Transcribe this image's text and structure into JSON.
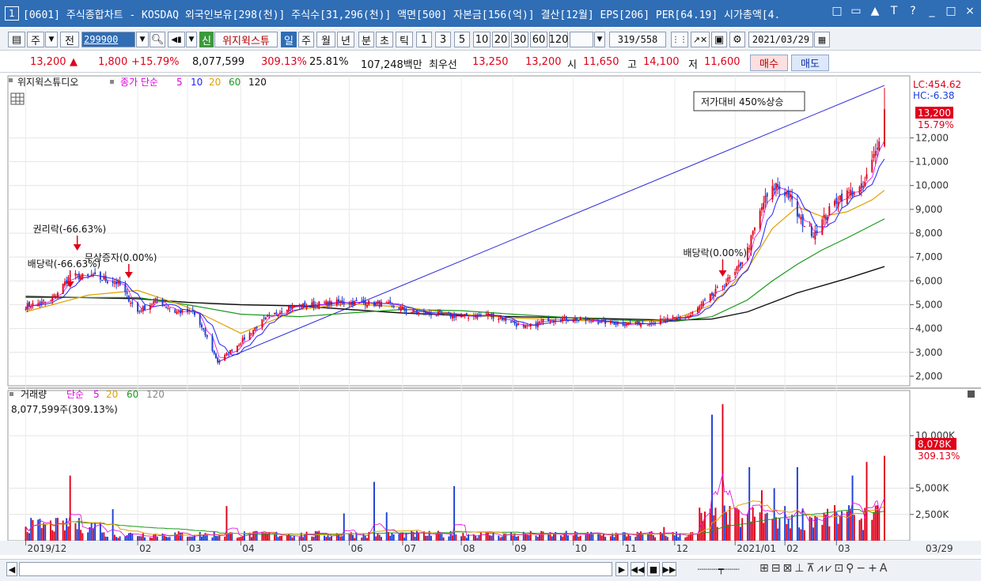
{
  "window": {
    "number": "1",
    "title": "[0601] 주식종합차트 - KOSDAQ 외국인보유[298(천)] 주식수[31,296(천)] 액면[500] 자본금[156(억)] 결산[12월] EPS[206] PER[64.19] 시가총액[4.",
    "controls": [
      "□",
      "▭",
      "▲",
      "T",
      "?",
      "_",
      "□",
      "×"
    ]
  },
  "toolbar": {
    "week_label": "주",
    "prev_label": "전",
    "stock_code": "299900",
    "stock_name": "위지윅스튜",
    "shin_label": "신",
    "periods": [
      "일",
      "주",
      "월",
      "년",
      "분",
      "초",
      "틱"
    ],
    "active_period": "일",
    "intervals": [
      "1",
      "3",
      "5",
      "10",
      "20",
      "30",
      "60",
      "120"
    ],
    "count": "319/558",
    "date": "2021/03/29"
  },
  "quote": {
    "price": "13,200",
    "up_symbol": "▲",
    "change": "1,800",
    "change_pct": "+15.79%",
    "volume": "8,077,599",
    "volume_ratio": "309.13%",
    "turnover": "25.81%",
    "amount": "107,248백만",
    "best_label": "최우선",
    "best_ask": "13,250",
    "best_bid": "13,200",
    "open_label": "시",
    "open": "11,650",
    "high_label": "고",
    "high": "14,100",
    "low_label": "저",
    "low": "11,600",
    "buy_label": "매수",
    "sell_label": "매도"
  },
  "price_panel": {
    "name": "위지윅스튜디오",
    "series_label": "종가 단순",
    "ma_labels": [
      "5",
      "10",
      "20",
      "60",
      "120"
    ],
    "lc": "LC:454.62",
    "hc": "HC:-6.38",
    "price_tag": "13,200",
    "pct_tag": "15.79%",
    "annotation_box": "저가대비 450%상승",
    "events": [
      "권리락(-66.63%)",
      "무상증자(0.00%)",
      "배당락(-66.63%)",
      "배당락(0.00%)"
    ]
  },
  "volume_panel": {
    "title": "거래량",
    "series_label": "단순",
    "ma_labels": [
      "5",
      "20",
      "60",
      "120"
    ],
    "current": "8,077,599주(309.13%)",
    "tag": "8,078K",
    "tag_pct": "309.13%"
  },
  "colors": {
    "up": "#e0001a",
    "down": "#1a3fd6",
    "ma5": "#e000e0",
    "ma10": "#2020ff",
    "ma20": "#e0a000",
    "ma60": "#1a9a1a",
    "ma120": "#111111",
    "trendline": "#2a2ad6",
    "title_bar": "#2f6db5"
  },
  "chart_data": [
    {
      "type": "candlestick",
      "title": "위지윅스튜디오",
      "ylim": [
        1600,
        14600
      ],
      "y_ticks": [
        2000,
        3000,
        4000,
        5000,
        6000,
        7000,
        8000,
        9000,
        10000,
        11000,
        12000
      ],
      "y_tick_labels": [
        "2,000",
        "3,000",
        "4,000",
        "5,000",
        "6,000",
        "7,000",
        "8,000",
        "9,000",
        "10,000",
        "11,000",
        "12,000"
      ],
      "x_labels": [
        {
          "label": "2019/12",
          "date": "2019-12-02"
        },
        {
          "label": "02",
          "date": "2020-02-03"
        },
        {
          "label": "03",
          "date": "2020-03-02"
        },
        {
          "label": "04",
          "date": "2020-04-01"
        },
        {
          "label": "05",
          "date": "2020-05-04"
        },
        {
          "label": "06",
          "date": "2020-06-01"
        },
        {
          "label": "07",
          "date": "2020-07-01"
        },
        {
          "label": "08",
          "date": "2020-08-03"
        },
        {
          "label": "09",
          "date": "2020-09-01"
        },
        {
          "label": "10",
          "date": "2020-10-05"
        },
        {
          "label": "11",
          "date": "2020-11-02"
        },
        {
          "label": "12",
          "date": "2020-12-01"
        },
        {
          "label": "2021/01",
          "date": "2021-01-04"
        },
        {
          "label": "02",
          "date": "2021-02-01"
        },
        {
          "label": "03",
          "date": "2021-03-02"
        },
        {
          "label": "03/29",
          "date": "2021-03-29"
        }
      ],
      "close_path": [
        [
          "2019-12-02",
          4950
        ],
        [
          "2019-12-16",
          5150
        ],
        [
          "2019-12-27",
          6200
        ],
        [
          "2020-01-10",
          6150
        ],
        [
          "2020-01-23",
          5900
        ],
        [
          "2020-02-03",
          4700
        ],
        [
          "2020-02-14",
          5200
        ],
        [
          "2020-02-24",
          4700
        ],
        [
          "2020-03-05",
          4700
        ],
        [
          "2020-03-13",
          3600
        ],
        [
          "2020-03-19",
          2600
        ],
        [
          "2020-03-30",
          3300
        ],
        [
          "2020-04-13",
          4300
        ],
        [
          "2020-04-27",
          4900
        ],
        [
          "2020-05-11",
          5000
        ],
        [
          "2020-05-25",
          5100
        ],
        [
          "2020-06-08",
          5100
        ],
        [
          "2020-06-22",
          5000
        ],
        [
          "2020-07-06",
          4700
        ],
        [
          "2020-07-20",
          4600
        ],
        [
          "2020-08-03",
          4500
        ],
        [
          "2020-08-18",
          4600
        ],
        [
          "2020-08-31",
          4300
        ],
        [
          "2020-09-07",
          4000
        ],
        [
          "2020-09-21",
          4400
        ],
        [
          "2020-10-05",
          4400
        ],
        [
          "2020-10-19",
          4300
        ],
        [
          "2020-11-02",
          4200
        ],
        [
          "2020-11-16",
          4250
        ],
        [
          "2020-11-30",
          4400
        ],
        [
          "2020-12-10",
          4550
        ],
        [
          "2020-12-22",
          5400
        ],
        [
          "2021-01-04",
          6300
        ],
        [
          "2021-01-11",
          7300
        ],
        [
          "2021-01-20",
          9300
        ],
        [
          "2021-01-27",
          10000
        ],
        [
          "2021-02-03",
          9600
        ],
        [
          "2021-02-09",
          8600
        ],
        [
          "2021-02-17",
          8000
        ],
        [
          "2021-02-24",
          8700
        ],
        [
          "2021-03-03",
          9500
        ],
        [
          "2021-03-10",
          9700
        ],
        [
          "2021-03-17",
          9900
        ],
        [
          "2021-03-24",
          11400
        ],
        [
          "2021-03-29",
          13200
        ]
      ],
      "last_candle": {
        "date": "2021-03-29",
        "open": 11650,
        "high": 14100,
        "low": 11600,
        "close": 13200
      },
      "moving_averages": {
        "ma20": [
          [
            "2019-12-02",
            4700
          ],
          [
            "2020-01-06",
            5400
          ],
          [
            "2020-02-03",
            5600
          ],
          [
            "2020-03-02",
            4900
          ],
          [
            "2020-04-01",
            3800
          ],
          [
            "2020-05-04",
            4800
          ],
          [
            "2020-06-01",
            5050
          ],
          [
            "2020-07-01",
            4900
          ],
          [
            "2020-08-03",
            4600
          ],
          [
            "2020-09-01",
            4450
          ],
          [
            "2020-10-05",
            4350
          ],
          [
            "2020-11-02",
            4250
          ],
          [
            "2020-12-01",
            4400
          ],
          [
            "2020-12-22",
            5000
          ],
          [
            "2021-01-11",
            6500
          ],
          [
            "2021-01-25",
            8200
          ],
          [
            "2021-02-08",
            9100
          ],
          [
            "2021-02-22",
            8700
          ],
          [
            "2021-03-08",
            8900
          ],
          [
            "2021-03-22",
            9400
          ],
          [
            "2021-03-29",
            9800
          ]
        ],
        "ma60": [
          [
            "2019-12-02",
            5300
          ],
          [
            "2020-02-03",
            5300
          ],
          [
            "2020-03-02",
            5000
          ],
          [
            "2020-04-01",
            4600
          ],
          [
            "2020-05-04",
            4500
          ],
          [
            "2020-06-01",
            4650
          ],
          [
            "2020-07-01",
            4800
          ],
          [
            "2020-08-03",
            4750
          ],
          [
            "2020-09-01",
            4600
          ],
          [
            "2020-10-05",
            4450
          ],
          [
            "2020-11-02",
            4350
          ],
          [
            "2020-12-01",
            4300
          ],
          [
            "2020-12-22",
            4500
          ],
          [
            "2021-01-11",
            5200
          ],
          [
            "2021-01-25",
            6000
          ],
          [
            "2021-02-08",
            6700
          ],
          [
            "2021-02-22",
            7300
          ],
          [
            "2021-03-08",
            7800
          ],
          [
            "2021-03-29",
            8600
          ]
        ],
        "ma120": [
          [
            "2019-12-02",
            5350
          ],
          [
            "2020-02-03",
            5250
          ],
          [
            "2020-03-02",
            5100
          ],
          [
            "2020-04-01",
            5000
          ],
          [
            "2020-05-04",
            4950
          ],
          [
            "2020-06-01",
            4800
          ],
          [
            "2020-07-01",
            4650
          ],
          [
            "2020-08-03",
            4550
          ],
          [
            "2020-09-01",
            4500
          ],
          [
            "2020-10-05",
            4450
          ],
          [
            "2020-11-02",
            4400
          ],
          [
            "2020-12-01",
            4350
          ],
          [
            "2020-12-22",
            4400
          ],
          [
            "2021-01-11",
            4700
          ],
          [
            "2021-01-25",
            5100
          ],
          [
            "2021-02-08",
            5500
          ],
          [
            "2021-02-22",
            5800
          ],
          [
            "2021-03-08",
            6100
          ],
          [
            "2021-03-29",
            6600
          ]
        ]
      },
      "trendline": [
        [
          "2020-03-19",
          2600
        ],
        [
          "2021-03-29",
          14200
        ]
      ],
      "event_markers": [
        {
          "label": "권리락(-66.63%)",
          "date": "2019-12-31"
        },
        {
          "label": "무상증자(0.00%)",
          "date": "2020-01-29"
        },
        {
          "label": "배당락(-66.63%)",
          "date": "2019-12-27"
        },
        {
          "label": "배당락(0.00%)",
          "date": "2020-12-28"
        }
      ]
    },
    {
      "type": "bar",
      "title": "거래량",
      "ylim": [
        0,
        14000
      ],
      "y_ticks": [
        2500,
        5000,
        10000
      ],
      "y_tick_labels": [
        "2,500K",
        "5,000K",
        "10,000K"
      ],
      "unit": "K",
      "spikes": [
        [
          "2019-12-27",
          6200
        ],
        [
          "2020-01-20",
          3000
        ],
        [
          "2020-03-24",
          3300
        ],
        [
          "2020-05-29",
          2600
        ],
        [
          "2020-06-15",
          5600
        ],
        [
          "2020-06-22",
          2700
        ],
        [
          "2020-07-30",
          5200
        ],
        [
          "2020-11-25",
          1300
        ],
        [
          "2020-12-22",
          12000
        ],
        [
          "2020-12-28",
          13000
        ],
        [
          "2021-01-12",
          7000
        ],
        [
          "2021-01-19",
          4800
        ],
        [
          "2021-01-26",
          5000
        ],
        [
          "2021-02-08",
          7000
        ],
        [
          "2021-03-11",
          6200
        ],
        [
          "2021-03-19",
          7500
        ],
        [
          "2021-03-29",
          8078
        ]
      ]
    }
  ]
}
